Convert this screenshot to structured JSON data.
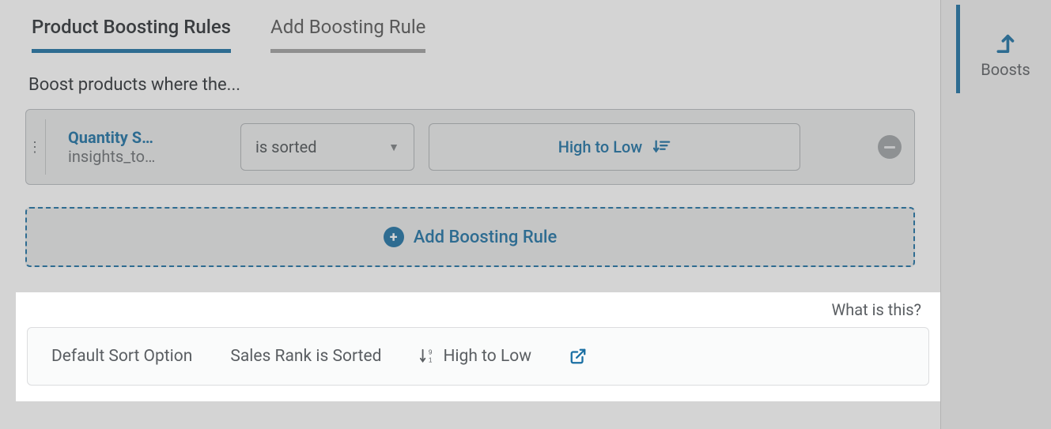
{
  "tabs": {
    "rules": "Product Boosting Rules",
    "add": "Add Boosting Rule"
  },
  "section_label": "Boost products where the...",
  "rule": {
    "field_title": "Quantity S…",
    "field_sub": "insights_to…",
    "operator": "is sorted",
    "value": "High to Low"
  },
  "add_rule_label": "Add Boosting Rule",
  "info": {
    "what_is": "What is this?",
    "default_label": "Default Sort Option",
    "sort_field": "Sales Rank is Sorted",
    "direction": "High to Low"
  },
  "side_tab": "Boosts"
}
